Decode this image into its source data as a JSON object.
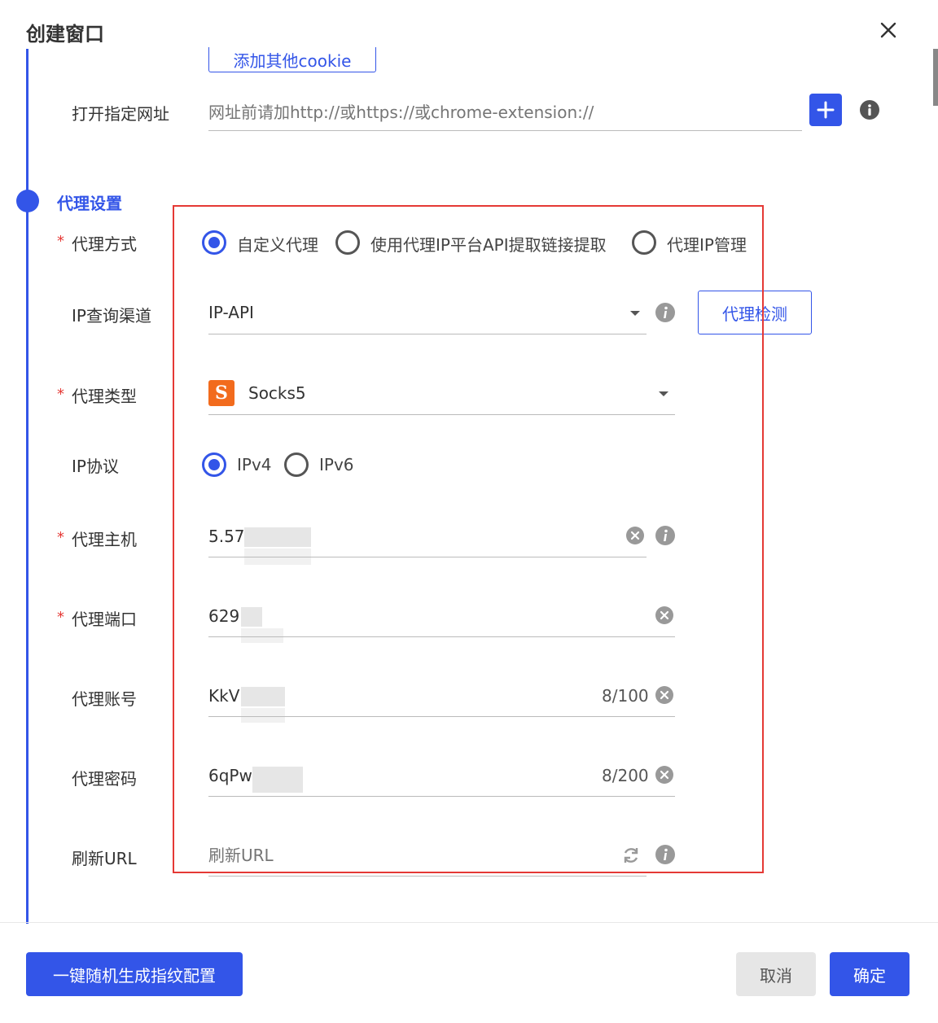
{
  "dialog": {
    "title": "创建窗口"
  },
  "cookie": {
    "add_button": "添加其他cookie"
  },
  "open_url": {
    "label": "打开指定网址",
    "placeholder": "网址前请加http://或https://或chrome-extension://"
  },
  "proxy_section": {
    "title": "代理设置",
    "mode": {
      "label": "代理方式",
      "options": [
        "自定义代理",
        "使用代理IP平台API提取链接提取",
        "代理IP管理"
      ],
      "selected": "自定义代理"
    },
    "ip_query": {
      "label": "IP查询渠道",
      "value": "IP-API",
      "check_button": "代理检测"
    },
    "proxy_type": {
      "label": "代理类型",
      "value": "Socks5",
      "icon_letter": "S"
    },
    "ip_protocol": {
      "label": "IP协议",
      "options": [
        "IPv4",
        "IPv6"
      ],
      "selected": "IPv4"
    },
    "host": {
      "label": "代理主机",
      "value": "5.57"
    },
    "port": {
      "label": "代理端口",
      "value": "629"
    },
    "account": {
      "label": "代理账号",
      "value": "KkV",
      "counter": "8/100"
    },
    "password": {
      "label": "代理密码",
      "value": "6qPw",
      "counter": "8/200"
    },
    "refresh_url": {
      "label": "刷新URL",
      "placeholder": "刷新URL"
    }
  },
  "required_mark": "*",
  "footer": {
    "random_button": "一键随机生成指纹配置",
    "cancel": "取消",
    "confirm": "确定"
  },
  "colors": {
    "accent": "#3355e8",
    "required": "#e53935",
    "highlight_box": "#e53935",
    "socks_logo": "#f26b1d"
  }
}
